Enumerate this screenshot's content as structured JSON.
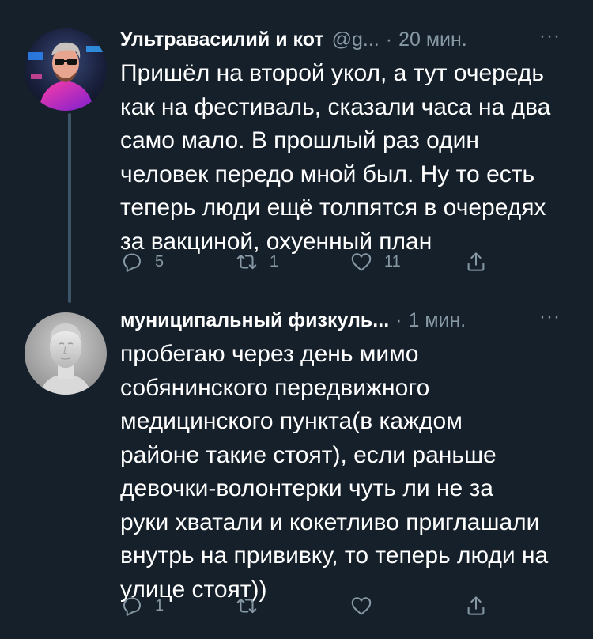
{
  "tweets": [
    {
      "name": "Ультравасилий и кот",
      "handle": "@g...",
      "separator": "·",
      "time": "20 мин.",
      "more": "···",
      "text": "Пришёл на второй укол, а тут очередь\nкак на фестиваль, сказали часа на два\nсамо мало. В прошлый раз один\nчеловек передо мной был. Ну то есть\nтеперь люди ещё толпятся в очередях\nза вакциной, охуенный план",
      "replies": "5",
      "retweets": "1",
      "likes": "11"
    },
    {
      "name": "муниципальный физкуль...",
      "separator": "·",
      "time": "1 мин.",
      "more": "···",
      "text": "пробегаю через день мимо\nсобянинского передвижного\nмедицинского пункта(в каждом\nрайоне такие стоят), если раньше\nдевочки-волонтерки чуть ли не за\nруки хватали и кокетливо приглашали\nвнутрь на прививку, то теперь люди на\nулице стоят))",
      "replies": "1",
      "retweets": "",
      "likes": ""
    }
  ],
  "colors": {
    "background": "#15202b",
    "text_primary": "#ffffff",
    "text_secondary": "#8899a6",
    "thread_line": "#3d5466"
  },
  "icons": {
    "reply": "reply-icon",
    "retweet": "retweet-icon",
    "like": "heart-icon",
    "share": "share-icon",
    "more": "more-icon"
  }
}
